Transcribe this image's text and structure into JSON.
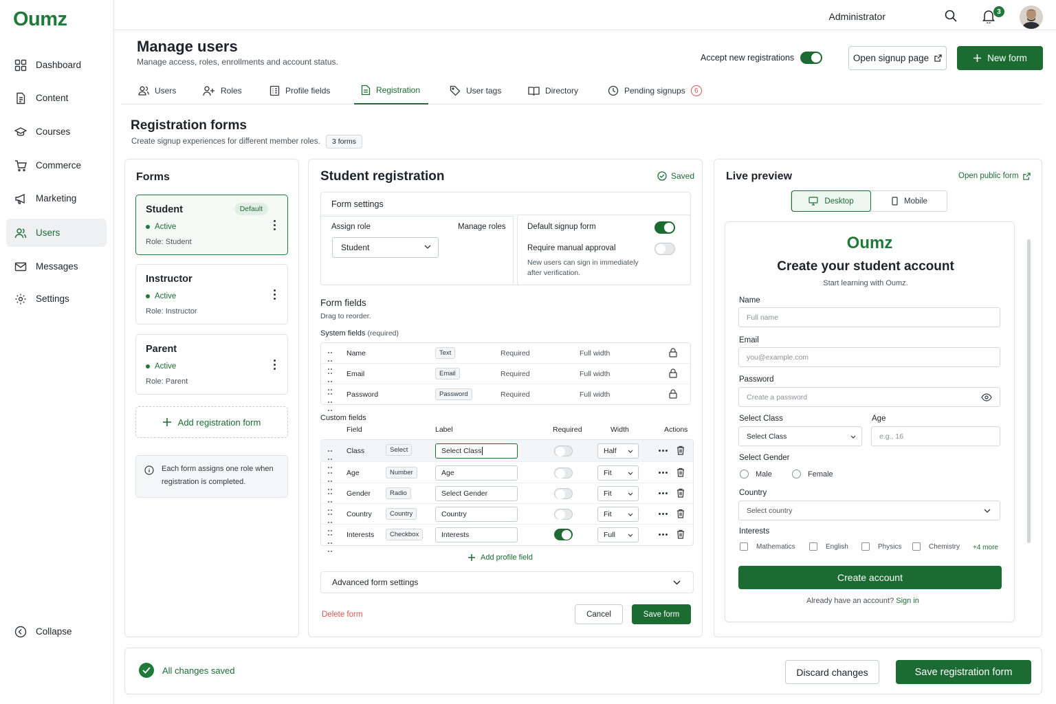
{
  "app": {
    "name": "Oumz"
  },
  "sidebar": {
    "items": [
      {
        "label": "Dashboard",
        "icon": "grid-icon"
      },
      {
        "label": "Content",
        "icon": "document-icon"
      },
      {
        "label": "Courses",
        "icon": "graduation-cap-icon"
      },
      {
        "label": "Commerce",
        "icon": "cart-icon"
      },
      {
        "label": "Marketing",
        "icon": "megaphone-icon"
      },
      {
        "label": "Users",
        "icon": "users-icon",
        "active": true
      },
      {
        "label": "Messages",
        "icon": "mail-icon"
      },
      {
        "label": "Settings",
        "icon": "gear-icon"
      }
    ],
    "collapse_label": "Collapse"
  },
  "topbar": {
    "user_label": "Administrator",
    "notification_count": "3"
  },
  "header": {
    "title": "Manage users",
    "subtitle": "Manage access, roles, enrollments and account status.",
    "accept_label": "Accept new registrations",
    "accept_on": true,
    "open_signup_label": "Open signup page",
    "new_form_label": "New form"
  },
  "tabs": [
    {
      "label": "Users",
      "icon": "user-icon"
    },
    {
      "label": "Roles",
      "icon": "user-plus-icon"
    },
    {
      "label": "Profile fields",
      "icon": "id-card-icon"
    },
    {
      "label": "Registration",
      "icon": "form-icon",
      "active": true
    },
    {
      "label": "User tags",
      "icon": "tag-icon"
    },
    {
      "label": "Directory",
      "icon": "book-icon"
    },
    {
      "label": "Pending signups",
      "icon": "clock-icon",
      "badge": "6"
    }
  ],
  "section": {
    "title": "Registration forms",
    "subtitle": "Create signup experiences for different member roles.",
    "count_label": "3 forms"
  },
  "forms_panel": {
    "title": "Forms",
    "forms": [
      {
        "name": "Student",
        "badge": "Default",
        "status": "Active",
        "role": "Role: Student",
        "selected": true
      },
      {
        "name": "Instructor",
        "status": "Active",
        "role": "Role: Instructor"
      },
      {
        "name": "Parent",
        "status": "Active",
        "role": "Role: Parent"
      }
    ],
    "add_label": "Add registration form",
    "info_text": "Each form assigns one role when registration is completed."
  },
  "editor": {
    "title": "Student registration",
    "saved_label": "Saved",
    "settings_title": "Form settings",
    "assign_role_label": "Assign role",
    "manage_roles_label": "Manage roles",
    "role_value": "Student",
    "default_signup_label": "Default signup form",
    "default_signup_on": true,
    "manual_approval_label": "Require manual approval",
    "manual_approval_on": false,
    "manual_approval_help_1": "New users can sign in immediately",
    "manual_approval_help_2": "after verification.",
    "fields_title": "Form fields",
    "fields_hint": "Drag to reorder.",
    "system_title": "System fields",
    "system_suffix": "(required)",
    "system_fields": [
      {
        "name": "Name",
        "type": "Text",
        "req": "Required",
        "width": "Full width"
      },
      {
        "name": "Email",
        "type": "Email",
        "req": "Required",
        "width": "Full width"
      },
      {
        "name": "Password",
        "type": "Password",
        "req": "Required",
        "width": "Full width"
      }
    ],
    "custom_title": "Custom fields",
    "custom_headers": {
      "field": "Field",
      "label": "Label",
      "required": "Required",
      "width": "Width",
      "actions": "Actions"
    },
    "custom_fields": [
      {
        "name": "Class",
        "type": "Select",
        "label": "Select Class",
        "required": false,
        "width": "Half"
      },
      {
        "name": "Age",
        "type": "Number",
        "label": "Age",
        "required": false,
        "width": "Fit"
      },
      {
        "name": "Gender",
        "type": "Radio",
        "label": "Select Gender",
        "required": false,
        "width": "Fit"
      },
      {
        "name": "Country",
        "type": "Country",
        "label": "Country",
        "required": false,
        "width": "Fit"
      },
      {
        "name": "Interests",
        "type": "Checkbox",
        "label": "Interests",
        "required": true,
        "width": "Full"
      }
    ],
    "add_profile_field_label": "Add profile field",
    "advanced_label": "Advanced form settings",
    "delete_label": "Delete form",
    "cancel_label": "Cancel",
    "save_label": "Save form"
  },
  "preview": {
    "title": "Live preview",
    "open_public_label": "Open public form",
    "desktop_label": "Desktop",
    "mobile_label": "Mobile",
    "brand": "Oumz",
    "heading": "Create your student account",
    "subheading": "Start learning with Oumz.",
    "name_label": "Name",
    "name_placeholder": "Full name",
    "email_label": "Email",
    "email_placeholder": "you@example.com",
    "password_label": "Password",
    "password_placeholder": "Create a password",
    "class_label": "Select Class",
    "class_placeholder": "Select Class",
    "age_label": "Age",
    "age_placeholder": "e.g., 16",
    "gender_label": "Select Gender",
    "gender_options": [
      "Male",
      "Female"
    ],
    "country_label": "Country",
    "country_placeholder": "Select country",
    "interests_label": "Interests",
    "interests_options": [
      "Mathematics",
      "English",
      "Physics",
      "Chemistry"
    ],
    "interests_more": "+4 more",
    "submit_label": "Create account",
    "signin_prompt": "Already have an account?",
    "signin_link": "Sign in"
  },
  "footer": {
    "status": "All changes saved",
    "discard_label": "Discard changes",
    "save_label": "Save registration form"
  },
  "colors": {
    "brand": "#1f7a3a",
    "primary": "#1b6b32",
    "danger": "#d9534f"
  }
}
